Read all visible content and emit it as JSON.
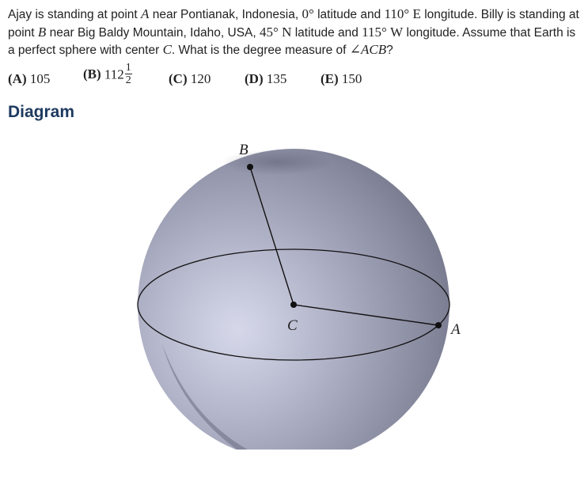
{
  "problem": {
    "t1": "Ajay is standing at point ",
    "A": "A",
    "t2": " near Pontianak, Indonesia, ",
    "lat_a": "0°",
    "t3": " latitude and ",
    "lon_a": "110°",
    "E": "E",
    "t4": " longitude. Billy is standing at point ",
    "B": "B",
    "t5": " near Big Baldy Mountain, Idaho, USA, ",
    "lat_b": "45°",
    "N": "N",
    "t6": " latitude and ",
    "lon_b": "115°",
    "W": "W",
    "t7": " longitude. Assume that Earth is a perfect sphere with center ",
    "C": "C",
    "t8": ". What is the degree measure of ",
    "angle": "∠ACB",
    "t9": "?"
  },
  "choices": [
    {
      "letter": "(A)",
      "value": "105"
    },
    {
      "letter": "(B)",
      "value": "112",
      "frac_num": "1",
      "frac_den": "2"
    },
    {
      "letter": "(C)",
      "value": "120"
    },
    {
      "letter": "(D)",
      "value": "135"
    },
    {
      "letter": "(E)",
      "value": "150"
    }
  ],
  "heading": "Diagram",
  "diagram": {
    "label_B": "B",
    "label_C": "C",
    "label_A": "A"
  }
}
